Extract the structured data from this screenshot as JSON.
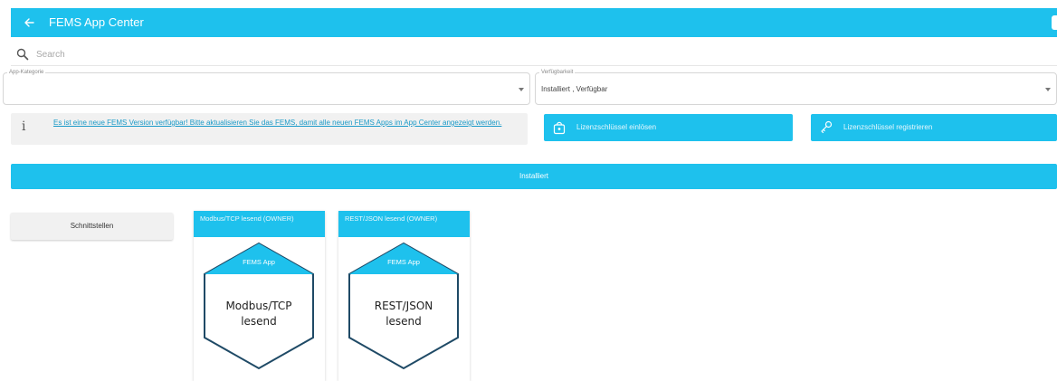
{
  "header": {
    "title": "FEMS App Center",
    "back_icon": "arrow-left-icon",
    "background": "#1ec1ed"
  },
  "search": {
    "placeholder": "Search",
    "value": ""
  },
  "filters": {
    "category": {
      "label": "App-Kategorie",
      "value": ""
    },
    "availability": {
      "label": "Verfügbarkeit",
      "value": "Installiert , Verfügbar"
    }
  },
  "info": {
    "icon": "info-icon",
    "message": "Es ist eine neue FEMS Version verfügbar! Bitte aktualisieren Sie das FEMS, damit alle neuen FEMS Apps im App Center angezeigt werden."
  },
  "license": {
    "redeem_label": "Lizenzschlüssel einlösen",
    "redeem_icon": "gift-icon",
    "register_label": "Lizenzschlüssel registrieren",
    "register_icon": "key-icon"
  },
  "section": {
    "installed_label": "Installiert"
  },
  "categories": [
    {
      "label": "Schnittstellen"
    }
  ],
  "apps": [
    {
      "header": "Modbus/TCP lesend (OWNER)",
      "badge": "FEMS App",
      "name_line1": "Modbus/TCP",
      "name_line2": "lesend"
    },
    {
      "header": "REST/JSON lesend (OWNER)",
      "badge": "FEMS App",
      "name_line1": "REST/JSON",
      "name_line2": "lesend"
    }
  ],
  "colors": {
    "accent": "#1ec1ed",
    "hex_outline": "#1f4a66",
    "link": "#1a9ac8"
  }
}
